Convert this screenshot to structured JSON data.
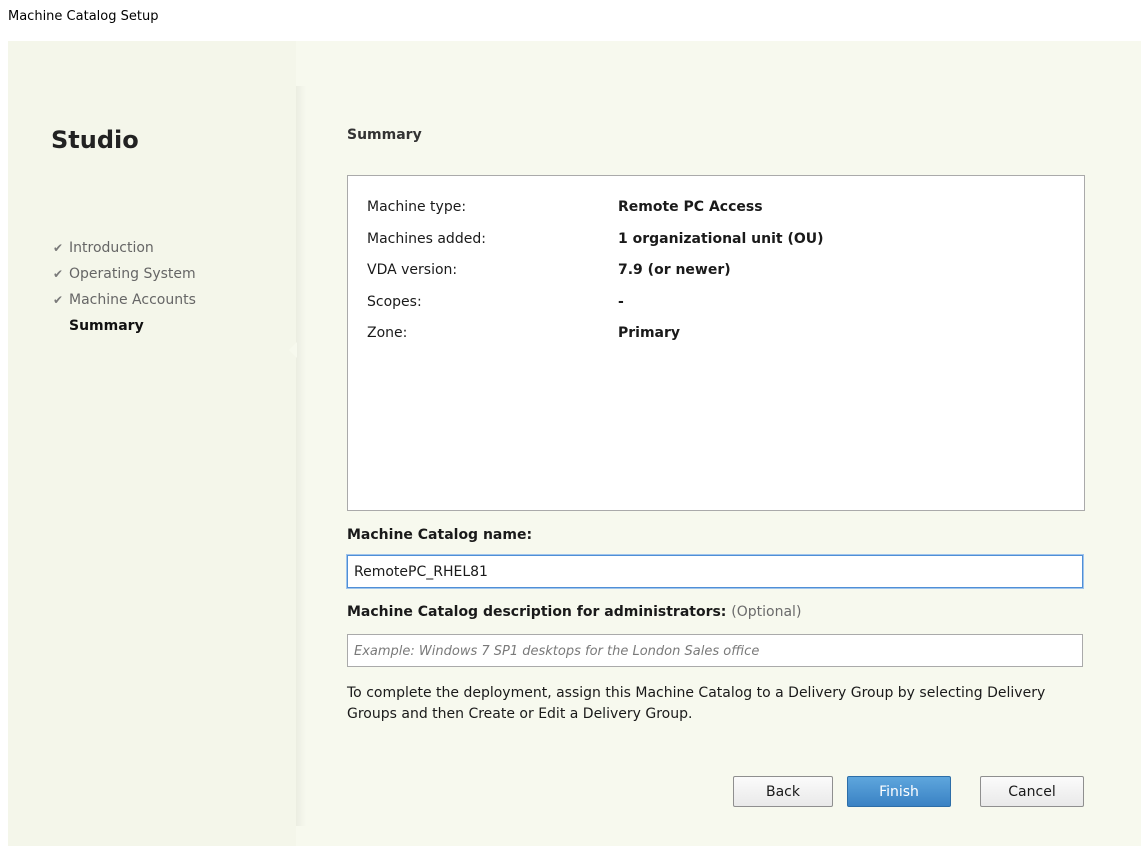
{
  "window": {
    "title": "Machine Catalog Setup"
  },
  "sidebar": {
    "brand": "Studio",
    "steps": [
      {
        "label": "Introduction",
        "completed": true
      },
      {
        "label": "Operating System",
        "completed": true
      },
      {
        "label": "Machine Accounts",
        "completed": true
      },
      {
        "label": "Summary",
        "completed": false,
        "current": true
      }
    ]
  },
  "main": {
    "heading": "Summary",
    "summary": [
      {
        "label": "Machine type:",
        "value": "Remote PC Access"
      },
      {
        "label": "Machines added:",
        "value": "1 organizational unit (OU)"
      },
      {
        "label": "VDA version:",
        "value": "7.9 (or newer)"
      },
      {
        "label": "Scopes:",
        "value": "-"
      },
      {
        "label": "Zone:",
        "value": "Primary"
      }
    ],
    "catalog_name": {
      "label": "Machine Catalog name:",
      "value": "RemotePC_RHEL81"
    },
    "catalog_description": {
      "label": "Machine Catalog description for administrators:",
      "optional": "(Optional)",
      "value": "",
      "placeholder": "Example: Windows 7 SP1 desktops for the London Sales office"
    },
    "info": "To complete the deployment, assign this Machine Catalog to a Delivery Group by selecting Delivery Groups and then Create or Edit a Delivery Group."
  },
  "buttons": {
    "back": "Back",
    "finish": "Finish",
    "cancel": "Cancel"
  },
  "colors": {
    "panel_background": "#f7f9ee",
    "accent": "#3a82c4",
    "focus_border": "#4f8fd6"
  },
  "icons": {
    "step_complete": "checkmark-icon"
  }
}
